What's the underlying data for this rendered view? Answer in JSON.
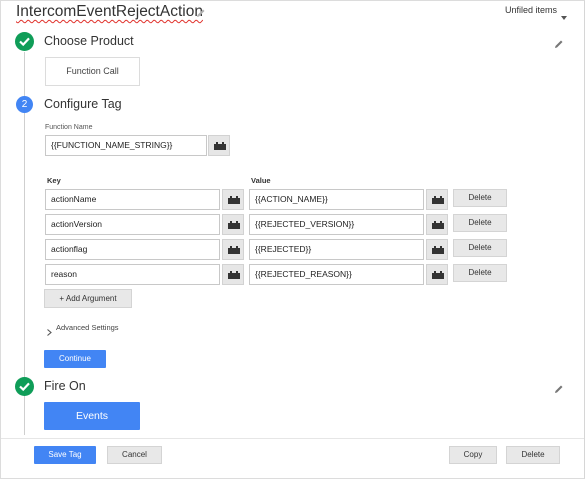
{
  "header": {
    "tag_name": "IntercomEventRejectAction",
    "folder_label": "Unfiled items"
  },
  "steps": {
    "product": {
      "title": "Choose Product",
      "selected_label": "Function Call"
    },
    "configure": {
      "number": "2",
      "title": "Configure Tag",
      "function_name_label": "Function Name",
      "function_name_value": "{{FUNCTION_NAME_STRING}}",
      "key_header": "Key",
      "value_header": "Value",
      "arguments": [
        {
          "key": "actionName",
          "value": "{{ACTION_NAME}}",
          "delete": "Delete"
        },
        {
          "key": "actionVersion",
          "value": "{{REJECTED_VERSION}}",
          "delete": "Delete"
        },
        {
          "key": "actionflag",
          "value": "{{REJECTED}}",
          "delete": "Delete"
        },
        {
          "key": "reason",
          "value": "{{REJECTED_REASON}}",
          "delete": "Delete"
        }
      ],
      "add_argument": "+ Add Argument",
      "advanced_settings": "Advanced Settings",
      "continue_label": "Continue"
    },
    "fire_on": {
      "title": "Fire On",
      "events_label": "Events"
    }
  },
  "footer": {
    "save": "Save Tag",
    "cancel": "Cancel",
    "copy": "Copy",
    "delete": "Delete"
  },
  "colors": {
    "step_complete": "#0f9d58",
    "step_active": "#4285f4",
    "primary_button": "#4285f4"
  },
  "icons": {
    "edit": "pencil-icon",
    "check": "check-icon",
    "variable": "variable-picker-icon",
    "caret": "chevron-down-icon",
    "expand": "chevron-right-icon"
  }
}
